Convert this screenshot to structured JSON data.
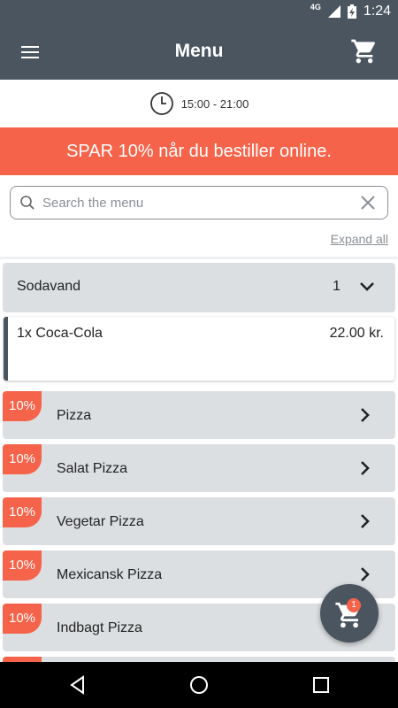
{
  "status_bar": {
    "network": "4G",
    "time": "1:24"
  },
  "app_bar": {
    "title": "Menu"
  },
  "hours": {
    "text": "15:00 - 21:00"
  },
  "promo": {
    "text": "SPAR 10% når du bestiller online."
  },
  "search": {
    "placeholder": "Search the menu",
    "value": ""
  },
  "expand_all": "Expand all",
  "expanded_category": {
    "label": "Sodavand",
    "count": "1",
    "items": [
      {
        "name": "1x Coca-Cola",
        "price": "22.00 kr."
      }
    ]
  },
  "categories": [
    {
      "badge": "10%",
      "label": "Pizza"
    },
    {
      "badge": "10%",
      "label": "Salat Pizza"
    },
    {
      "badge": "10%",
      "label": "Vegetar Pizza"
    },
    {
      "badge": "10%",
      "label": "Mexicansk Pizza"
    },
    {
      "badge": "10%",
      "label": "Indbagt Pizza"
    },
    {
      "badge": "",
      "label": ""
    }
  ],
  "cart": {
    "count": "1"
  },
  "colors": {
    "header": "#4a5560",
    "accent": "#f5634a",
    "row": "#dcdfe2"
  },
  "icons": [
    "hamburger-menu-icon",
    "cart-icon",
    "clock-icon",
    "search-icon",
    "close-icon",
    "chevron-down-icon",
    "chevron-right-icon",
    "back-icon",
    "home-icon",
    "recents-icon"
  ]
}
